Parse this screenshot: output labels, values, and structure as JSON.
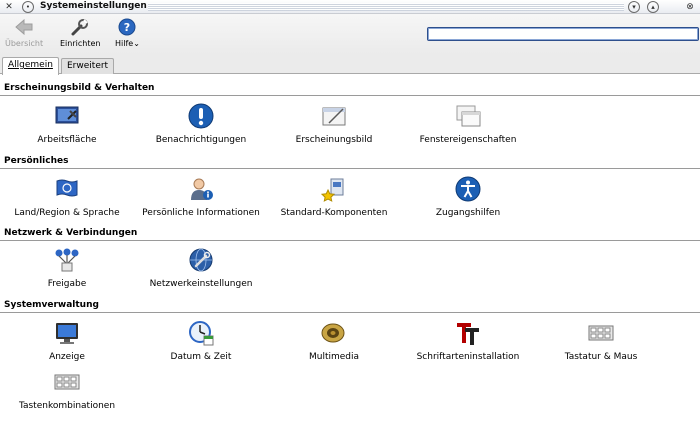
{
  "window": {
    "title": "Systemeinstellungen"
  },
  "toolbar": {
    "back_label": "Übersicht",
    "configure_label": "Einrichten",
    "help_label": "Hilfe",
    "help_arrow": "⌄",
    "search_value": ""
  },
  "tabs": [
    {
      "label": "Allgemein",
      "active": true
    },
    {
      "label": "Erweitert",
      "active": false
    }
  ],
  "sections": [
    {
      "title": "Erscheinungsbild & Verhalten",
      "items": [
        {
          "label": "Arbeitsfläche",
          "icon": "desktop-icon"
        },
        {
          "label": "Benachrichtigungen",
          "icon": "notification-icon"
        },
        {
          "label": "Erscheinungsbild",
          "icon": "appearance-icon"
        },
        {
          "label": "Fenstereigenschaften",
          "icon": "window-properties-icon"
        }
      ]
    },
    {
      "title": "Persönliches",
      "items": [
        {
          "label": "Land/Region & Sprache",
          "icon": "locale-flag-icon"
        },
        {
          "label": "Persönliche Informationen",
          "icon": "personal-info-icon"
        },
        {
          "label": "Standard-Komponenten",
          "icon": "default-components-icon"
        },
        {
          "label": "Zugangshilfen",
          "icon": "accessibility-icon"
        }
      ]
    },
    {
      "title": "Netzwerk & Verbindungen",
      "items": [
        {
          "label": "Freigabe",
          "icon": "sharing-icon"
        },
        {
          "label": "Netzwerkeinstellungen",
          "icon": "network-settings-icon"
        }
      ]
    },
    {
      "title": "Systemverwaltung",
      "items": [
        {
          "label": "Anzeige",
          "icon": "display-monitor-icon"
        },
        {
          "label": "Datum & Zeit",
          "icon": "date-time-icon"
        },
        {
          "label": "Multimedia",
          "icon": "multimedia-speaker-icon"
        },
        {
          "label": "Schriftarteninstallation",
          "icon": "font-installer-icon"
        },
        {
          "label": "Tastatur & Maus",
          "icon": "keyboard-mouse-icon"
        },
        {
          "label": "Tastenkombinationen",
          "icon": "shortcuts-keyboard-icon"
        }
      ]
    }
  ],
  "colors": {
    "accent_blue": "#1c5fb4",
    "section_line": "#9a9a9a",
    "search_border": "#2e4f8c"
  }
}
